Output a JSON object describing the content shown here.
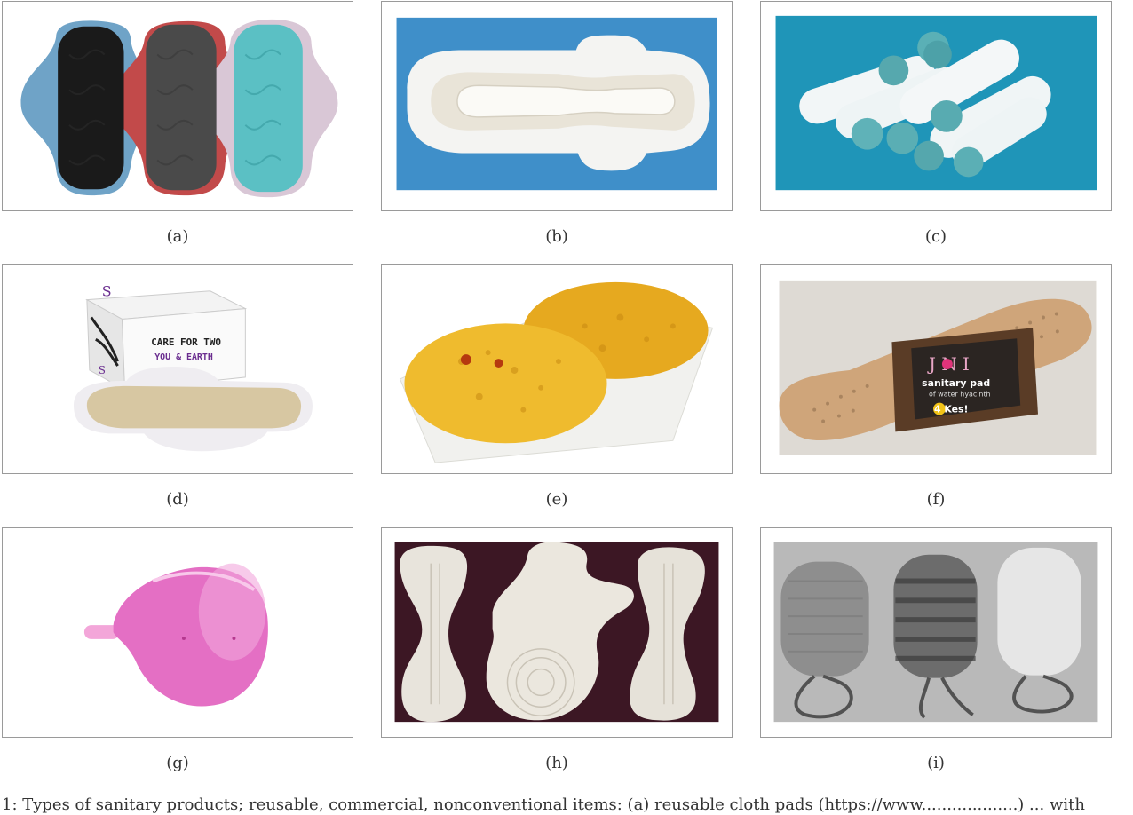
{
  "figure": {
    "panels": [
      {
        "id": "a",
        "label": "(a)",
        "subject": "cloth-pads"
      },
      {
        "id": "b",
        "label": "(b)",
        "subject": "disposable-pad"
      },
      {
        "id": "c",
        "label": "(c)",
        "subject": "tampons"
      },
      {
        "id": "d",
        "label": "(d)",
        "subject": "eco-pad-with-box"
      },
      {
        "id": "e",
        "label": "(e)",
        "subject": "sea-sponges"
      },
      {
        "id": "f",
        "label": "(f)",
        "subject": "water-hyacinth-pad"
      },
      {
        "id": "g",
        "label": "(g)",
        "subject": "menstrual-cup"
      },
      {
        "id": "h",
        "label": "(h)",
        "subject": "crochet-pads"
      },
      {
        "id": "i",
        "label": "(i)",
        "subject": "knitted-tampons"
      }
    ],
    "product_text": {
      "box_line1": "CARE FOR TWO",
      "box_line2": "YOU & EARTH",
      "box_logo": "S",
      "brand": "J   N I",
      "brand_sub1": "sanitary pad",
      "brand_sub2": "of water hyacinth",
      "brand_tag": "4 Kes!"
    },
    "caption": "1: Types of sanitary products; reusable, commercial, nonconventional items: (a) reusable cloth pads (https://www...................) ... with"
  },
  "colors": {
    "border": "#9a9a9a",
    "blue_bg": "#3f8fc9",
    "teal_bg": "#1f95b8",
    "sponge": "#e8b22a",
    "cup": "#e46fc4"
  }
}
